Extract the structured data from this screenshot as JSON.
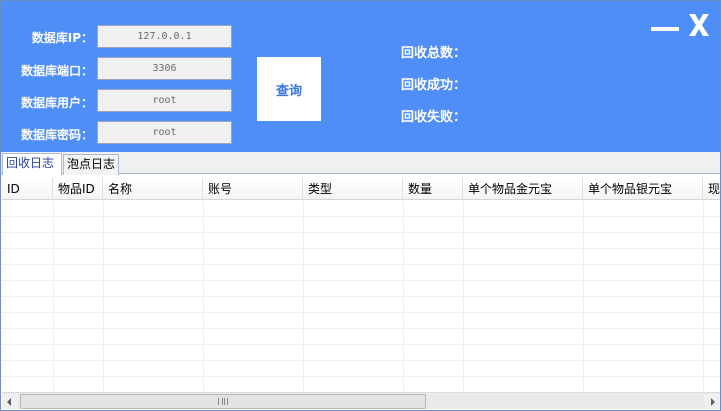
{
  "connection": {
    "ip_label": "数据库IP：",
    "ip_value": "127.0.0.1",
    "port_label": "数据库端口：",
    "port_value": "3306",
    "user_label": "数据库用户：",
    "user_value": "root",
    "password_label": "数据库密码：",
    "password_value": "root"
  },
  "query_button": "查询",
  "stats": {
    "total_label": "回收总数：",
    "success_label": "回收成功：",
    "fail_label": "回收失败："
  },
  "window": {
    "minimize_icon": "minimize-icon",
    "close_icon": "close-icon"
  },
  "tabs": [
    {
      "label": "回收日志",
      "active": true
    },
    {
      "label": "泡点日志",
      "active": false
    }
  ],
  "grid": {
    "columns": [
      "ID",
      "物品ID",
      "名称",
      "账号",
      "类型",
      "数量",
      "单个物品金元宝",
      "单个物品银元宝",
      "现"
    ]
  },
  "colors": {
    "header_bg": "#4f8ef7",
    "button_text": "#3a78e0",
    "active_tab_text": "#2a3e9e"
  }
}
